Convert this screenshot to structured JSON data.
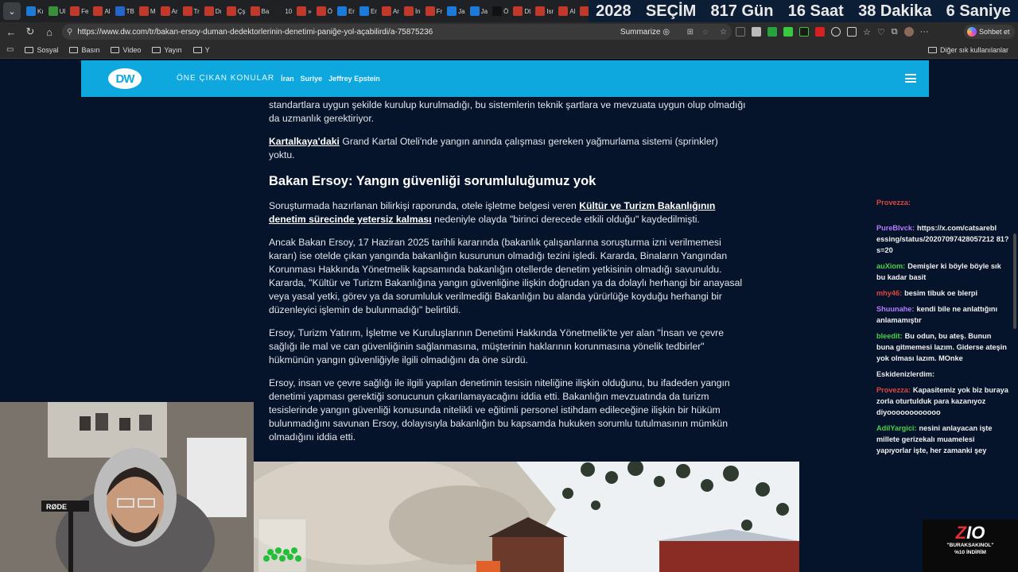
{
  "browser": {
    "tabs": [
      {
        "label": "Kı",
        "color": "#1c7ad9"
      },
      {
        "label": "Ul",
        "color": "#3a8f3a"
      },
      {
        "label": "Fe",
        "color": "#c0392b"
      },
      {
        "label": "Al",
        "color": "#c0392b"
      },
      {
        "label": "TB",
        "color": "#2266cc"
      },
      {
        "label": "M",
        "color": "#c0392b"
      },
      {
        "label": "Ar",
        "color": "#c0392b"
      },
      {
        "label": "Tr",
        "color": "#c0392b"
      },
      {
        "label": "Dı",
        "color": "#c0392b"
      },
      {
        "label": "Çş",
        "color": "#c0392b"
      },
      {
        "label": "Ba",
        "color": "#c0392b"
      },
      {
        "label": "10",
        "color": "#222222"
      },
      {
        "label": "»",
        "color": "#c0392b"
      },
      {
        "label": "Ö",
        "color": "#c0392b"
      },
      {
        "label": "Er",
        "color": "#1c7ad9"
      },
      {
        "label": "Er",
        "color": "#1c7ad9"
      },
      {
        "label": "Ar",
        "color": "#c0392b"
      },
      {
        "label": "İn",
        "color": "#c0392b"
      },
      {
        "label": "Fr",
        "color": "#c0392b"
      },
      {
        "label": "Ja",
        "color": "#1c7ad9"
      },
      {
        "label": "Ja",
        "color": "#1c7ad9"
      },
      {
        "label": "Ö",
        "color": "#111111"
      },
      {
        "label": "Dt",
        "color": "#c0392b"
      },
      {
        "label": "Isr",
        "color": "#c0392b"
      },
      {
        "label": "Al",
        "color": "#c0392b"
      },
      {
        "label": "Ar",
        "color": "#c0392b"
      },
      {
        "label": "Ar",
        "color": "#c0392b"
      }
    ],
    "countdown": {
      "year": "2028",
      "word": "SEÇİM",
      "days": "817 Gün",
      "hours": "16 Saat",
      "minutes": "38 Dakika",
      "seconds": "6 Saniye"
    },
    "url": "https://www.dw.com/tr/bakan-ersoy-duman-dedektorlerinin-denetimi-paniğe-yol-açabilirdi/a-75875236",
    "summarize_label": "Summarize",
    "sohbet_label": "Sohbet et",
    "bookmarks": [
      "Sosyal",
      "Basın",
      "Video",
      "Yayın",
      "Y"
    ],
    "bookmarks_other": "Diğer sık kullanılanlar",
    "icons": {
      "back": "back-arrow-icon",
      "refresh": "refresh-icon",
      "home": "home-icon",
      "menu": "more-dots-icon"
    }
  },
  "site": {
    "logo": "DW",
    "nav_heading": "ÖNE ÇIKAN KONULAR",
    "nav_links": [
      "İran",
      "Suriye",
      "Jeffrey Epstein"
    ]
  },
  "article": {
    "p0": "standartlara uygun şekilde kurulup kurulmadığı, bu sistemlerin teknik şartlara ve mevzuata uygun olup olmadığı da uzmanlık gerektiriyor.",
    "p1_link": "Kartalkaya'daki",
    "p1_rest": " Grand Kartal Oteli'nde yangın anında çalışması gereken yağmurlama sistemi (sprinkler) yoktu.",
    "heading": "Bakan Ersoy: Yangın güvenliği sorumluluğumuz yok",
    "p2_a": "Soruşturmada hazırlanan bilirkişi raporunda, otele işletme belgesi veren ",
    "p2_link": "Kültür ve Turizm Bakanlığının denetim sürecinde yetersiz kalması",
    "p2_b": " nedeniyle olayda \"birinci derecede etkili olduğu\" kaydedilmişti.",
    "p3": "Ancak Bakan Ersoy, 17 Haziran 2025 tarihli kararında (bakanlık çalışanlarına soruşturma izni verilmemesi kararı) ise otelde çıkan yangında bakanlığın kusurunun olmadığı tezini işledi. Kararda, Binaların Yangından Korunması Hakkında Yönetmelik kapsamında bakanlığın otellerde denetim yetkisinin olmadığı savunuldu. Kararda, \"Kültür ve Turizm Bakanlığına yangın güvenliğine ilişkin doğrudan ya da dolaylı herhangi bir anayasal veya yasal yetki, görev ya da sorumluluk verilmediği Bakanlığın bu alanda yürürlüğe koyduğu herhangi bir düzenleyici işlemin de bulunmadığı\" belirtildi.",
    "p4": "Ersoy, Turizm Yatırım, İşletme ve Kuruluşlarının Denetimi Hakkında Yönetmelik'te yer alan \"İnsan ve çevre sağlığı ile mal ve can güvenliğinin sağlanmasına, müşterinin haklarının korunmasına yönelik tedbirler\" hükmünün yangın güvenliğiyle ilgili olmadığını da öne sürdü.",
    "p5": "Ersoy, insan ve çevre sağlığı ile ilgili yapılan denetimin tesisin niteliğine ilişkin olduğunu, bu ifadeden yangın denetimi yapması gerektiği sonucunun çıkarılamayacağını iddia etti. Bakanlığın mevzuatında da turizm tesislerinde yangın güvenliği konusunda nitelikli ve eğitimli personel istihdam edileceğine ilişkin bir hüküm bulunmadığını savunan Ersoy, dolayısıyla bakanlığın bu kapsamda hukuken sorumlu tutulmasının mümkün olmadığını iddia etti."
  },
  "chat": [
    {
      "nick": "Provezza:",
      "text": "",
      "color": "#e0463c"
    },
    {
      "nick": "",
      "text": "",
      "color": "#e0463c"
    },
    {
      "nick": "PureBlvck:",
      "text": "https://x.com/catsarebl essing/status/20207097428057212 81?s=20",
      "color": "#b57cff"
    },
    {
      "nick": "auXiom:",
      "text": "Demişler ki böyle böyle sık bu kadar basit",
      "color": "#4bd14b"
    },
    {
      "nick": "mhy46:",
      "text": "besim tibuk oe blerpi",
      "color": "#e0463c"
    },
    {
      "nick": "Shuunahe:",
      "text": "kendi bile ne anlattığını anlamamıştır",
      "color": "#b57cff"
    },
    {
      "nick": "bleedit:",
      "text": "Bu odun, bu ateş. Bunun buna gitmemesi lazım. Giderse ateşin yok olması lazım. MOnke",
      "color": "#4bd14b"
    },
    {
      "nick": "Eskidenizlerdim:",
      "text": "",
      "color": "#e8e8e8"
    },
    {
      "nick": "Provezza:",
      "text": "Kapasitemiz yok biz buraya zorla oturtulduk para kazanıyoz diyoooooooooooo",
      "color": "#e0463c"
    },
    {
      "nick": "AdilYargici:",
      "text": "nesini anlayacan işte millete gerizekalı muamelesi yapıyorlar işte, her zamanki şey",
      "color": "#4bd14b"
    }
  ],
  "webcam": {
    "mic_label": "RØDE"
  },
  "overlay": {
    "logo_z": "Z",
    "logo_rest": "IO",
    "line1": "\"BURAKSAKINOL\"",
    "line2": "%10 İNDİRİM"
  }
}
